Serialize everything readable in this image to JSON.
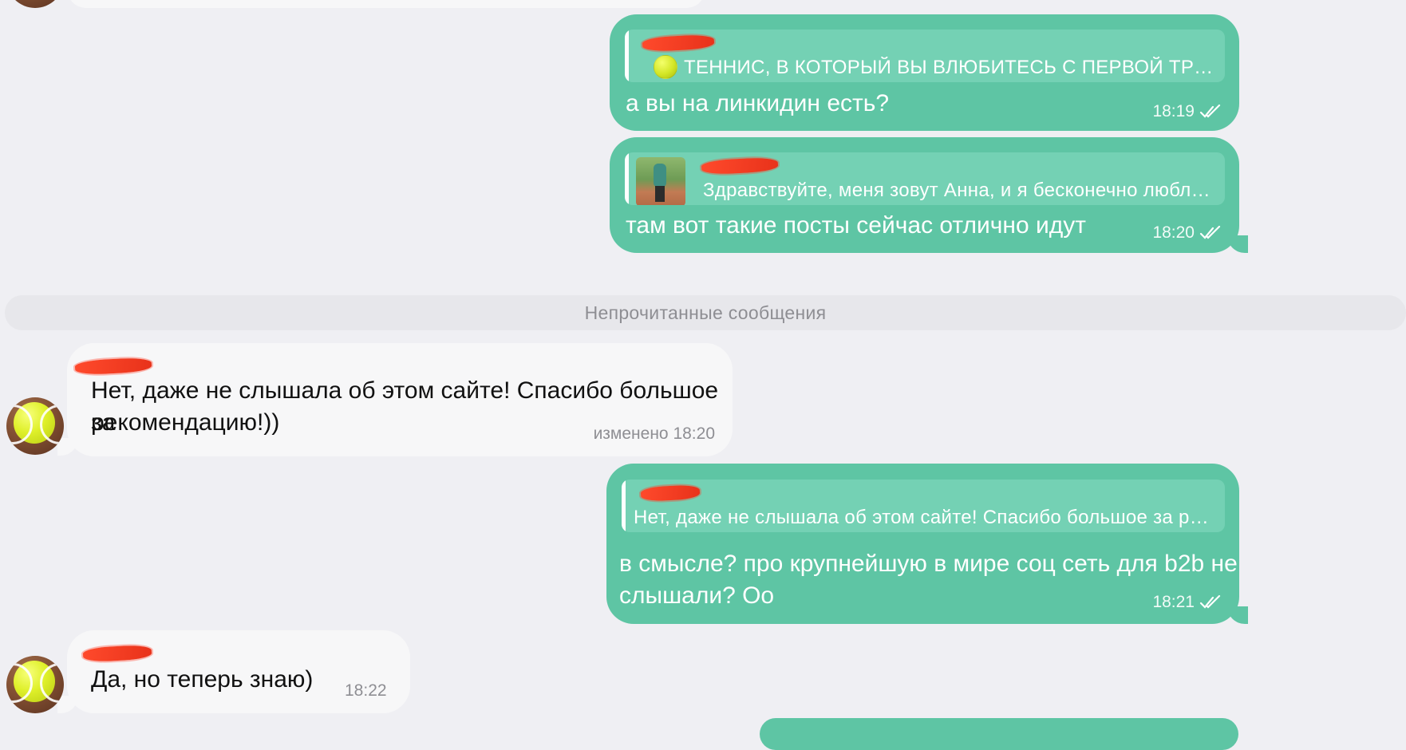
{
  "colors": {
    "outgoing_bubble": "#5ec5a4",
    "incoming_bubble": "#f7f7f8",
    "background": "#efeff3",
    "redaction": "#e8321a"
  },
  "messages": [
    {
      "reply_text": "ТЕННИС, В КОТОРЫЙ ВЫ ВЛЮБИТЕСЬ С ПЕРВОЙ ТРЕНИР...",
      "text": "а вы на линкидин есть?",
      "time": "18:19",
      "icon": "double-check-icon"
    },
    {
      "reply_text": "Здравствуйте, меня зовут Анна, и я бесконечно люблю б...",
      "text": "там вот такие посты сейчас отлично идут",
      "time": "18:20",
      "icon": "double-check-icon"
    },
    {
      "text_line1": "Нет, даже не слышала об этом сайте! Спасибо большое за",
      "text_line2": "рекомендацию!))",
      "time": "изменено 18:20"
    },
    {
      "reply_text": "Нет, даже не слышала об этом сайте! Спасибо большое за рек...",
      "text_line1": "в смысле? про крупнейшую в мире соц сеть для b2b не",
      "text_line2": "слышали? Оо",
      "time": "18:21",
      "icon": "double-check-icon"
    },
    {
      "text": "Да, но теперь знаю)",
      "time": "18:22"
    }
  ],
  "divider": {
    "label": "Непрочитанные сообщения"
  }
}
